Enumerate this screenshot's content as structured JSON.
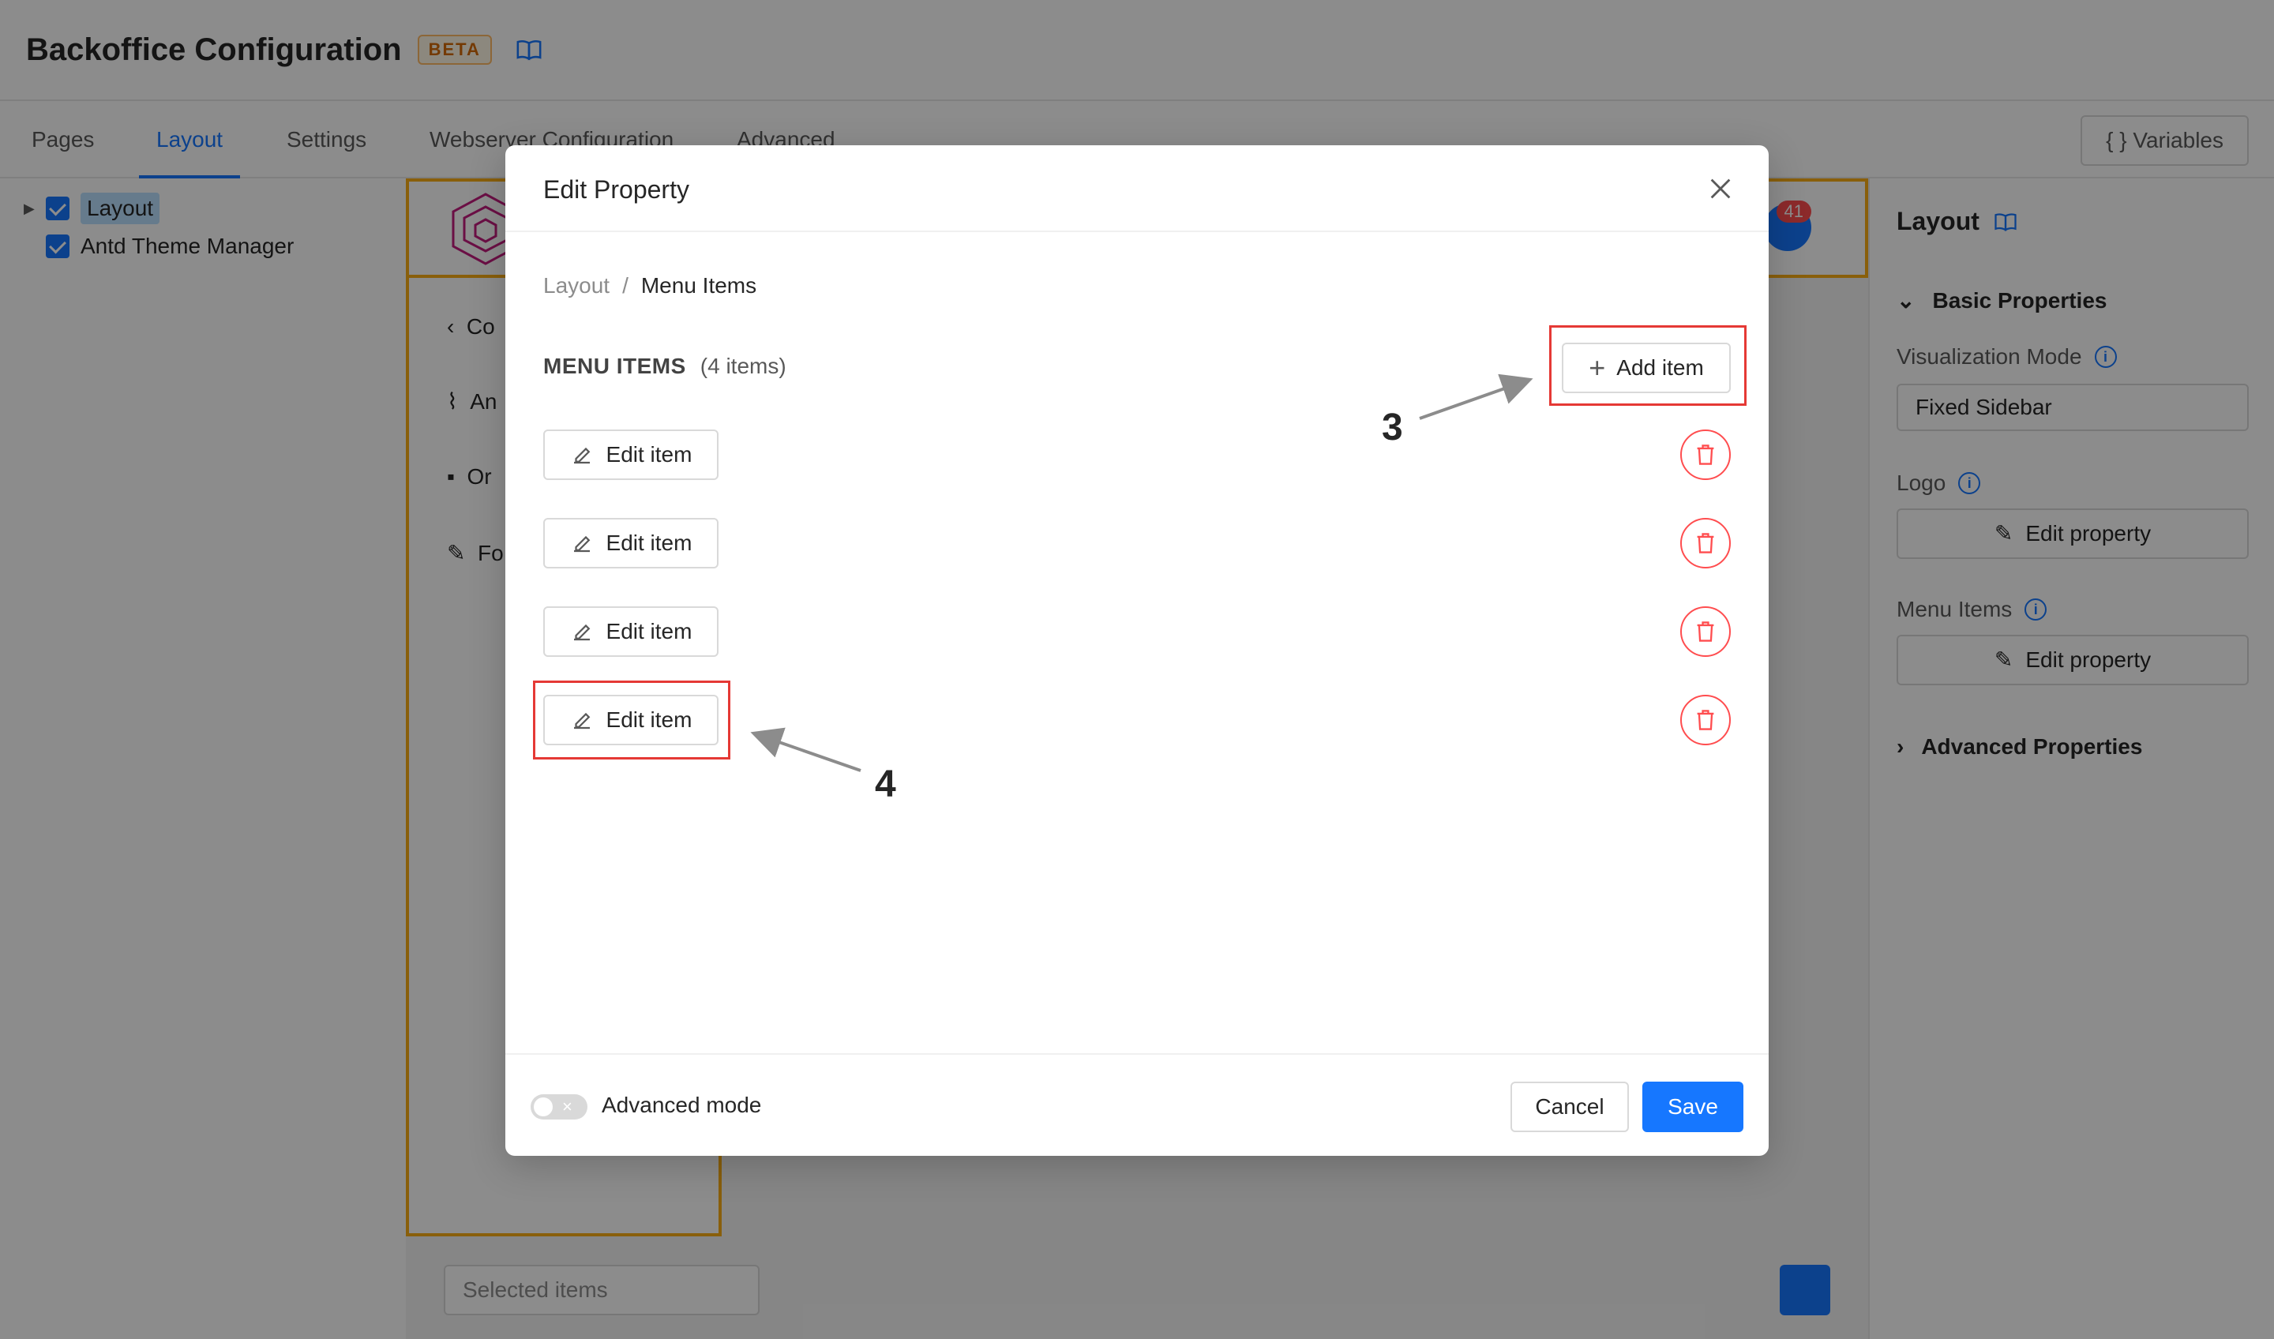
{
  "header": {
    "title": "Backoffice Configuration",
    "badge": "BETA"
  },
  "tabs": [
    "Pages",
    "Layout",
    "Settings",
    "Webserver Configuration",
    "Advanced"
  ],
  "active_tab": "Layout",
  "variables_button": "Variables",
  "tree": [
    {
      "label": "Layout",
      "checked": true,
      "selected": true
    },
    {
      "label": "Antd Theme Manager",
      "checked": true,
      "selected": false
    }
  ],
  "preview": {
    "sidebar_items": [
      "Co",
      "An",
      "Or",
      "Fo"
    ],
    "notification_count": "41",
    "selected_items_placeholder": "Selected items"
  },
  "right_panel": {
    "title": "Layout",
    "basic_section": "Basic Properties",
    "visualization_mode_label": "Visualization Mode",
    "visualization_mode_value": "Fixed Sidebar",
    "logo_label": "Logo",
    "logo_button": "Edit property",
    "menu_items_label": "Menu Items",
    "menu_items_button": "Edit property",
    "advanced_section": "Advanced Properties"
  },
  "modal": {
    "title": "Edit Property",
    "breadcrumb": [
      "Layout",
      "Menu Items"
    ],
    "breadcrumb_sep": "/",
    "section_title": "MENU ITEMS",
    "section_count": "(4 items)",
    "add_button": "Add item",
    "items": [
      {
        "edit_label": "Edit item"
      },
      {
        "edit_label": "Edit item"
      },
      {
        "edit_label": "Edit item"
      },
      {
        "edit_label": "Edit item"
      }
    ],
    "advanced_mode_label": "Advanced mode",
    "advanced_mode_on": false,
    "cancel": "Cancel",
    "save": "Save"
  },
  "annotations": {
    "add": "3",
    "edit": "4"
  },
  "colors": {
    "primary": "#1677ff",
    "danger": "#ff4d4f",
    "highlight": "#e53935",
    "preview_outline": "#faad14"
  }
}
